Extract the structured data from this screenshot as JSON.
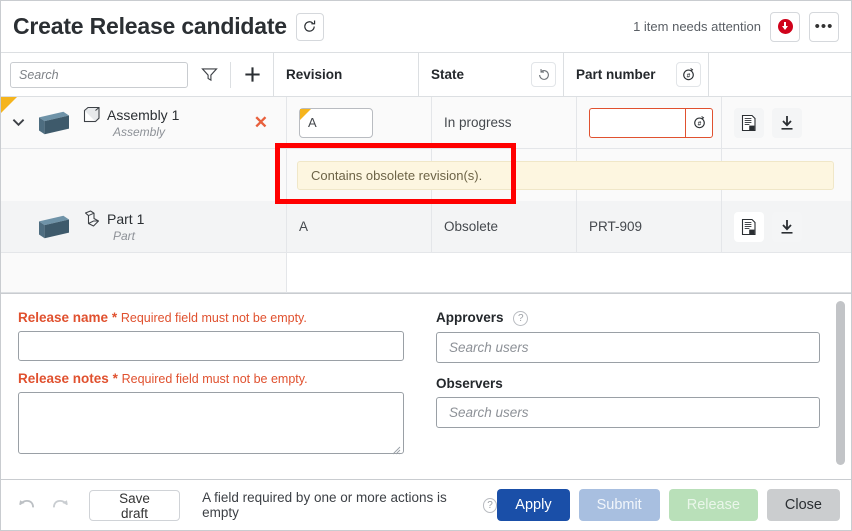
{
  "window": {
    "title": "Create Release candidate",
    "refresh_icon": "refresh-icon"
  },
  "header": {
    "attention_text": "1 item needs attention",
    "alert_icon": "alert-down-circle-icon",
    "more_icon": "ellipsis-icon",
    "more_label": "•••"
  },
  "toolbar": {
    "search_placeholder": "Search",
    "search_value": "",
    "filter_icon": "filter-icon",
    "add_icon": "plus-icon"
  },
  "table": {
    "columns": [
      {
        "key": "revision",
        "label": "Revision"
      },
      {
        "key": "state",
        "label": "State",
        "action_icon": "refresh-state-icon"
      },
      {
        "key": "part",
        "label": "Part number",
        "action_icon": "generate-number-icon"
      }
    ],
    "rows": [
      {
        "name": "Assembly 1",
        "type": "Assembly",
        "type_icon": "assembly-icon",
        "revision": "A",
        "state": "In progress",
        "part_number": "",
        "part_number_error": true,
        "flagged": true,
        "remove_label": "✕",
        "expanded": true,
        "preview_icon": "document-preview-icon",
        "download_icon": "download-icon"
      },
      {
        "name": "Part 1",
        "type": "Part",
        "type_icon": "part-icon",
        "revision": "A",
        "state": "Obsolete",
        "part_number": "PRT-909",
        "part_number_error": false,
        "flagged": false,
        "preview_icon": "document-preview-icon",
        "download_icon": "download-icon"
      }
    ],
    "warning_banner": "Contains obsolete revision(s)."
  },
  "form": {
    "release_name": {
      "label": "Release name",
      "required_marker": "*",
      "error": "Required field must not be empty.",
      "value": ""
    },
    "release_notes": {
      "label": "Release notes",
      "required_marker": "*",
      "error": "Required field must not be empty.",
      "value": ""
    },
    "approvers": {
      "label": "Approvers",
      "help_icon": "help-icon",
      "help_label": "?",
      "placeholder": "Search users",
      "value": ""
    },
    "observers": {
      "label": "Observers",
      "placeholder": "Search users",
      "value": ""
    }
  },
  "footer": {
    "undo_icon": "undo-arrow-icon",
    "redo_icon": "redo-arrow-icon",
    "save_draft_label": "Save draft",
    "message": "A field required by one or more actions is empty",
    "message_help_icon": "help-icon",
    "message_help_label": "?",
    "apply_label": "Apply",
    "submit_label": "Submit",
    "release_label": "Release",
    "close_label": "Close"
  },
  "colors": {
    "accent_blue": "#1a4fa8",
    "error_red": "#e0512f",
    "warn_yellow": "#fdf6e0",
    "flag_orange": "#f5b41d",
    "alert_red": "#d0021b",
    "annotation_red": "#ff0000"
  }
}
